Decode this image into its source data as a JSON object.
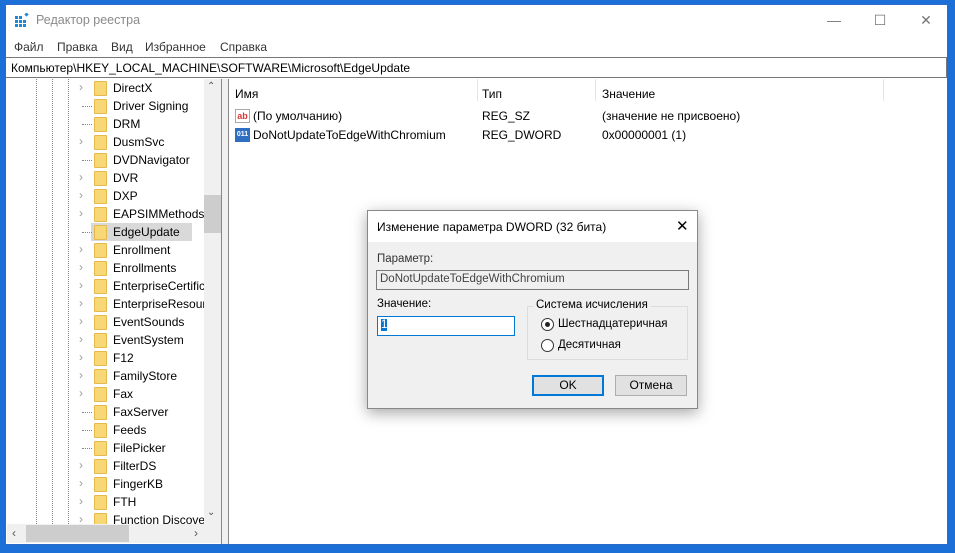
{
  "window": {
    "title": "Редактор реестра",
    "minimize": "—",
    "maximize": "☐",
    "close": "✕"
  },
  "menu": [
    "Файл",
    "Правка",
    "Вид",
    "Избранное",
    "Справка"
  ],
  "address": "Компьютер\\HKEY_LOCAL_MACHINE\\SOFTWARE\\Microsoft\\EdgeUpdate",
  "tree": [
    {
      "label": "DirectX",
      "expandable": true
    },
    {
      "label": "Driver Signing",
      "expandable": false
    },
    {
      "label": "DRM",
      "expandable": false
    },
    {
      "label": "DusmSvc",
      "expandable": true
    },
    {
      "label": "DVDNavigator",
      "expandable": false
    },
    {
      "label": "DVR",
      "expandable": true
    },
    {
      "label": "DXP",
      "expandable": true
    },
    {
      "label": "EAPSIMMethods",
      "expandable": true
    },
    {
      "label": "EdgeUpdate",
      "expandable": false,
      "selected": true
    },
    {
      "label": "Enrollment",
      "expandable": true
    },
    {
      "label": "Enrollments",
      "expandable": true
    },
    {
      "label": "EnterpriseCertific",
      "expandable": true
    },
    {
      "label": "EnterpriseResourc",
      "expandable": true
    },
    {
      "label": "EventSounds",
      "expandable": true
    },
    {
      "label": "EventSystem",
      "expandable": true
    },
    {
      "label": "F12",
      "expandable": true
    },
    {
      "label": "FamilyStore",
      "expandable": true
    },
    {
      "label": "Fax",
      "expandable": true
    },
    {
      "label": "FaxServer",
      "expandable": false
    },
    {
      "label": "Feeds",
      "expandable": false
    },
    {
      "label": "FilePicker",
      "expandable": false
    },
    {
      "label": "FilterDS",
      "expandable": true
    },
    {
      "label": "FingerKB",
      "expandable": true
    },
    {
      "label": "FTH",
      "expandable": true
    },
    {
      "label": "Function Discove",
      "expandable": true
    }
  ],
  "list": {
    "columns": [
      "Имя",
      "Тип",
      "Значение"
    ],
    "rows": [
      {
        "icon": "ab",
        "name": "(По умолчанию)",
        "type": "REG_SZ",
        "value": "(значение не присвоено)"
      },
      {
        "icon": "011",
        "name": "DoNotUpdateToEdgeWithChromium",
        "type": "REG_DWORD",
        "value": "0x00000001 (1)"
      }
    ]
  },
  "dialog": {
    "title": "Изменение параметра DWORD (32 бита)",
    "close": "✕",
    "param_label": "Параметр:",
    "param_value": "DoNotUpdateToEdgeWithChromium",
    "value_label": "Значение:",
    "value": "1",
    "base_group": "Система исчисления",
    "base_options": [
      "Шестнадцатеричная",
      "Десятичная"
    ],
    "selected_base": 0,
    "ok": "OK",
    "cancel": "Отмена"
  }
}
